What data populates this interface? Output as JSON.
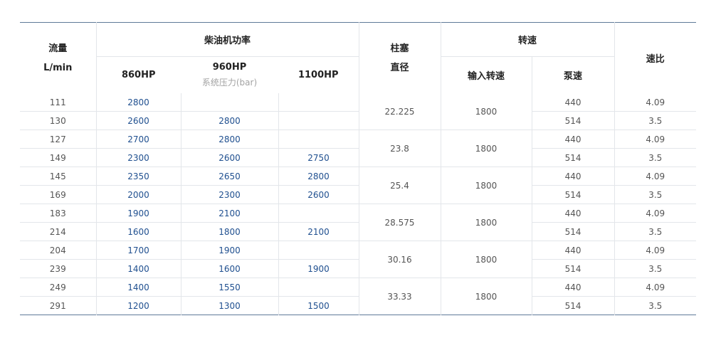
{
  "header": {
    "flow_line1": "流量",
    "flow_line2": "L/min",
    "diesel_power": "柴油机功率",
    "hp860": "860HP",
    "hp960": "960HP",
    "hp1100": "1100HP",
    "system_pressure": "系统压力(bar)",
    "plunger_line1": "柱塞",
    "plunger_line2": "直径",
    "speed": "转速",
    "input_speed": "输入转速",
    "pump_speed": "泵速",
    "ratio": "速比"
  },
  "rows": [
    {
      "flow": "111",
      "p860": "2800",
      "p960": "",
      "p1100": "",
      "pump": "440",
      "ratio": "4.09"
    },
    {
      "flow": "130",
      "p860": "2600",
      "p960": "2800",
      "p1100": "",
      "pump": "514",
      "ratio": "3.5"
    },
    {
      "flow": "127",
      "p860": "2700",
      "p960": "2800",
      "p1100": "",
      "pump": "440",
      "ratio": "4.09"
    },
    {
      "flow": "149",
      "p860": "2300",
      "p960": "2600",
      "p1100": "2750",
      "pump": "514",
      "ratio": "3.5"
    },
    {
      "flow": "145",
      "p860": "2350",
      "p960": "2650",
      "p1100": "2800",
      "pump": "440",
      "ratio": "4.09"
    },
    {
      "flow": "169",
      "p860": "2000",
      "p960": "2300",
      "p1100": "2600",
      "pump": "514",
      "ratio": "3.5"
    },
    {
      "flow": "183",
      "p860": "1900",
      "p960": "2100",
      "p1100": "",
      "pump": "440",
      "ratio": "4.09"
    },
    {
      "flow": "214",
      "p860": "1600",
      "p960": "1800",
      "p1100": "2100",
      "pump": "514",
      "ratio": "3.5"
    },
    {
      "flow": "204",
      "p860": "1700",
      "p960": "1900",
      "p1100": "",
      "pump": "440",
      "ratio": "4.09"
    },
    {
      "flow": "239",
      "p860": "1400",
      "p960": "1600",
      "p1100": "1900",
      "pump": "514",
      "ratio": "3.5"
    },
    {
      "flow": "249",
      "p860": "1400",
      "p960": "1550",
      "p1100": "",
      "pump": "440",
      "ratio": "4.09"
    },
    {
      "flow": "291",
      "p860": "1200",
      "p960": "1300",
      "p1100": "1500",
      "pump": "514",
      "ratio": "3.5"
    }
  ],
  "groups": [
    {
      "plunger": "22.225",
      "input": "1800"
    },
    {
      "plunger": "23.8",
      "input": "1800"
    },
    {
      "plunger": "25.4",
      "input": "1800"
    },
    {
      "plunger": "28.575",
      "input": "1800"
    },
    {
      "plunger": "30.16",
      "input": "1800"
    },
    {
      "plunger": "33.33",
      "input": "1800"
    }
  ]
}
